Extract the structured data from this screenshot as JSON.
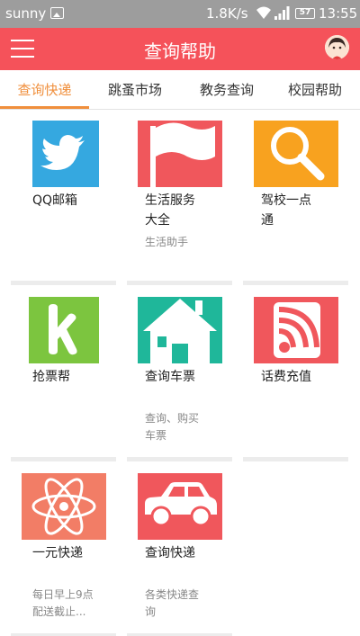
{
  "status_bar": {
    "carrier": "sunny",
    "speed": "1.8K/s",
    "battery": "57",
    "time": "13:55"
  },
  "header": {
    "title": "查询帮助",
    "menu_icon": "hamburger-menu-icon",
    "avatar_icon": "user-avatar"
  },
  "tabs": [
    {
      "label": "查询快递",
      "active": true
    },
    {
      "label": "跳蚤市场",
      "active": false
    },
    {
      "label": "教务查询",
      "active": false
    },
    {
      "label": "校园帮助",
      "active": false
    }
  ],
  "colors": {
    "accent": "#f5525a",
    "tab_active": "#f08f3c",
    "status_bar": "#9d9d9d"
  },
  "services": [
    {
      "name": "QQ邮箱",
      "subtitle": "",
      "icon": "twitter-bird-icon",
      "icon_bg": "#35a8e0"
    },
    {
      "name": "生活服务大全",
      "subtitle": "生活助手",
      "icon": "flag-icon",
      "icon_bg": "#f0575c"
    },
    {
      "name": "驾校一点通",
      "subtitle": "",
      "icon": "search-icon",
      "icon_bg": "#f8a21f"
    },
    {
      "name": "抢票帮",
      "subtitle": "",
      "icon": "k-letter-icon",
      "icon_bg": "#7cc53f"
    },
    {
      "name": "查询车票",
      "subtitle": "查询、购买车票",
      "icon": "house-icon",
      "icon_bg": "#1fb79a"
    },
    {
      "name": "话费充值",
      "subtitle": "",
      "icon": "rss-icon",
      "icon_bg": "#f0575c"
    },
    {
      "name": "一元快递",
      "subtitle": "每日早上9点配送截止...",
      "icon": "atom-icon",
      "icon_bg": "#f27d66"
    },
    {
      "name": "查询快递",
      "subtitle": "各类快递查询",
      "icon": "car-icon",
      "icon_bg": "#f0575c"
    }
  ]
}
